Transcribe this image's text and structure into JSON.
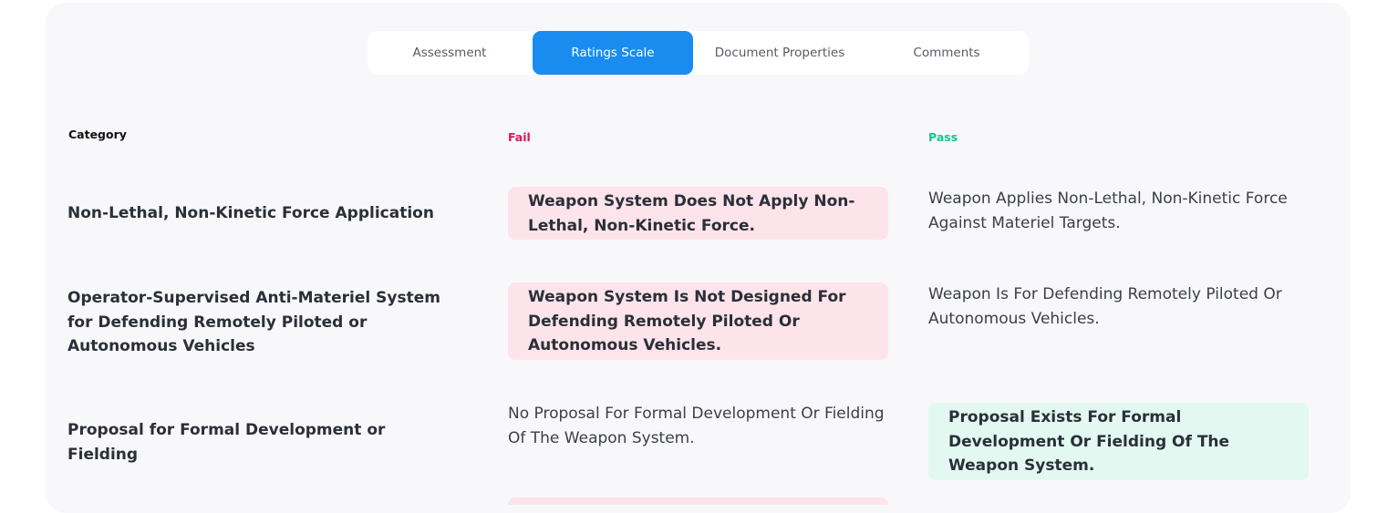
{
  "tabs": [
    {
      "label": "Assessment",
      "active": false
    },
    {
      "label": "Ratings Scale",
      "active": true
    },
    {
      "label": "Document Properties",
      "active": false
    },
    {
      "label": "Comments",
      "active": false
    }
  ],
  "table": {
    "headers": {
      "category": "Category",
      "fail": "Fail",
      "pass": "Pass"
    },
    "rows": [
      {
        "category": "Non-Lethal, Non-Kinetic Force Application",
        "fail": "Weapon System Does Not Apply Non-Lethal, Non-Kinetic Force.",
        "pass": "Weapon Applies Non-Lethal, Non-Kinetic Force Against Materiel Targets.",
        "highlight": "fail"
      },
      {
        "category": "Operator-Supervised Anti-Materiel System for Defending Remotely Piloted or Autonomous Vehicles",
        "fail": "Weapon System Is Not Designed For Defending Remotely Piloted Or Autonomous Vehicles.",
        "pass": "Weapon Is For Defending Remotely Piloted Or Autonomous Vehicles.",
        "highlight": "fail"
      },
      {
        "category": "Proposal for Formal Development or Fielding",
        "fail": "No Proposal For Formal Development Or Fielding Of The Weapon System.",
        "pass": "Proposal Exists For Formal Development Or Fielding Of The Weapon System.",
        "highlight": "pass"
      }
    ]
  },
  "colors": {
    "accent": "#1a8cf0",
    "fail": "#e0115f",
    "pass": "#17c48f",
    "fail_bg": "#fde4ea",
    "pass_bg": "#e3f8f1"
  }
}
